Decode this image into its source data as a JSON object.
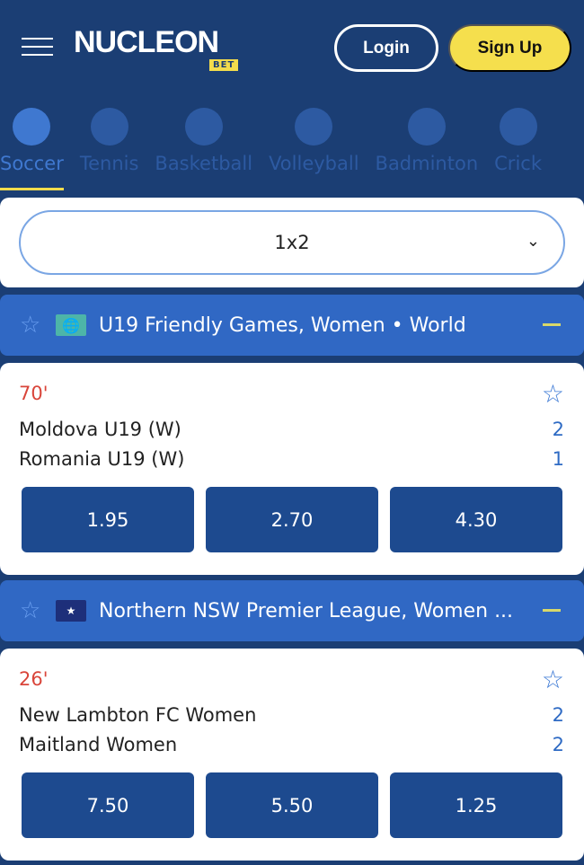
{
  "header": {
    "logo": "NUCLEON",
    "logo_sub": "BET",
    "login": "Login",
    "signup": "Sign Up"
  },
  "sports": [
    {
      "label": "Soccer",
      "icon": "soccer-ball-icon",
      "active": true
    },
    {
      "label": "Tennis",
      "icon": "tennis-ball-icon"
    },
    {
      "label": "Basketball",
      "icon": "basketball-icon"
    },
    {
      "label": "Volleyball",
      "icon": "volleyball-icon"
    },
    {
      "label": "Badminton",
      "icon": "shuttlecock-icon"
    },
    {
      "label": "Crick",
      "icon": "cricket-bat-icon"
    }
  ],
  "market": {
    "selected": "1x2"
  },
  "leagues": [
    {
      "title": "U19 Friendly Games, Women • World",
      "flag": "globe-icon",
      "match": {
        "minute": "70'",
        "home": "Moldova U19 (W)",
        "away": "Romania U19 (W)",
        "home_score": "2",
        "away_score": "1",
        "odds": [
          "1.95",
          "2.70",
          "4.30"
        ]
      }
    },
    {
      "title": "Northern NSW Premier League, Women ...",
      "flag": "australia-flag-icon",
      "match": {
        "minute": "26'",
        "home": "New Lambton FC Women",
        "away": "Maitland Women",
        "home_score": "2",
        "away_score": "2",
        "odds": [
          "7.50",
          "5.50",
          "1.25"
        ]
      }
    }
  ],
  "colors": {
    "background": "#1b3e74",
    "accent": "#f5df4d",
    "league_header": "#3068c4",
    "odds_button": "#1d4a8f",
    "live_minute": "#d9453a"
  }
}
